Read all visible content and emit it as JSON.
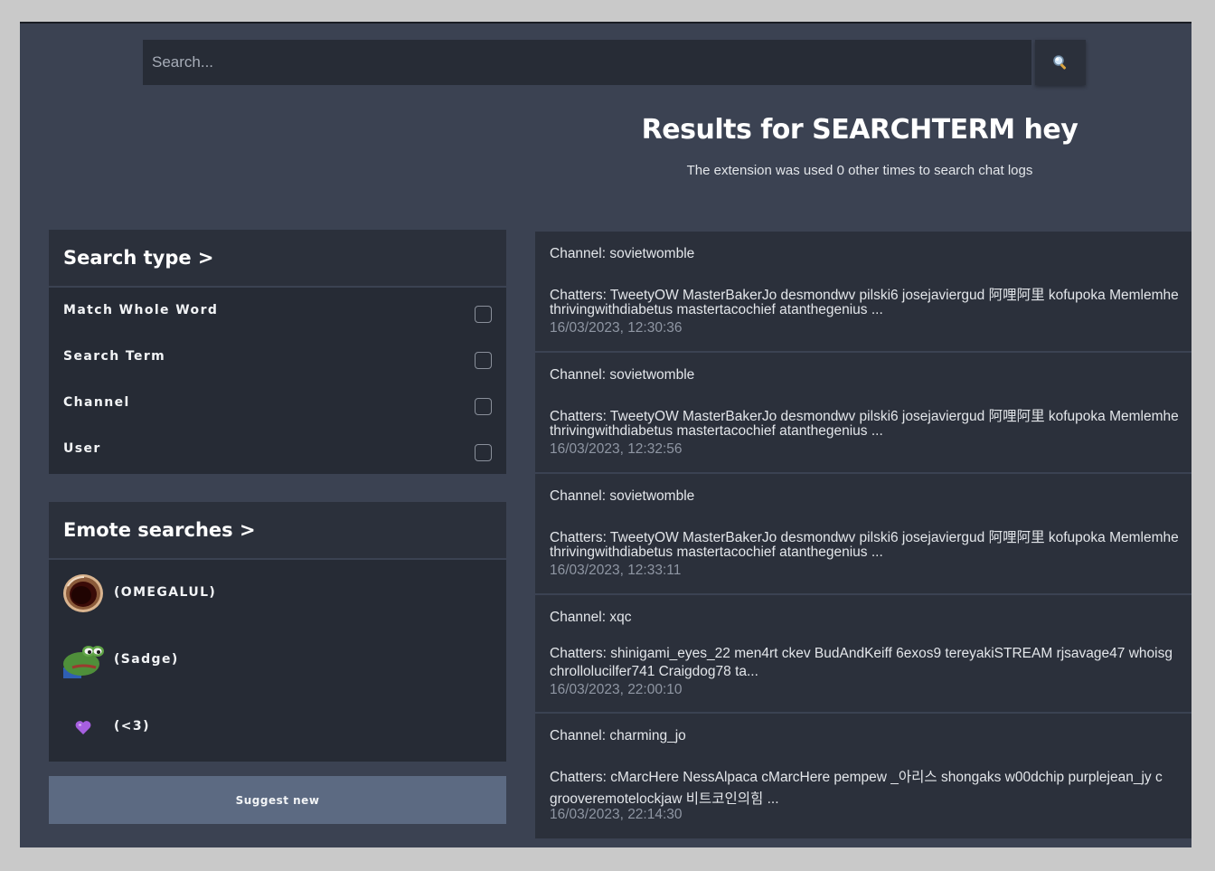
{
  "search": {
    "placeholder": "Search..."
  },
  "header": {
    "title": "Results for SEARCHTERM hey",
    "subtitle": "The extension was used 0 other times to search chat logs"
  },
  "search_type": {
    "title": "Search type >",
    "options": [
      {
        "label": "Match Whole Word",
        "checked": false
      },
      {
        "label": "Search Term",
        "checked": false
      },
      {
        "label": "Channel",
        "checked": false
      },
      {
        "label": "User",
        "checked": false
      }
    ]
  },
  "emote_searches": {
    "title": "Emote searches >",
    "emotes": [
      {
        "label": "(OMEGALUL)",
        "icon": "omegalul-emote-icon"
      },
      {
        "label": "(Sadge)",
        "icon": "sadge-emote-icon"
      },
      {
        "label": "(<3)",
        "icon": "purple-heart-icon"
      }
    ],
    "suggest_label": "Suggest new"
  },
  "results": [
    {
      "channel": "Channel: sovietwomble",
      "chatters_line1": "Chatters: TweetyOW MasterBakerJo desmondwv pilski6 josejaviergud 阿哩阿里 kofupoka Memlemhe",
      "chatters_line2": "thrivingwithdiabetus mastertacochief atanthegenius ...",
      "date": "16/03/2023, 12:30:36"
    },
    {
      "channel": "Channel: sovietwomble",
      "chatters_line1": "Chatters: TweetyOW MasterBakerJo desmondwv pilski6 josejaviergud 阿哩阿里 kofupoka Memlemhe",
      "chatters_line2": "thrivingwithdiabetus mastertacochief atanthegenius ...",
      "date": "16/03/2023, 12:32:56"
    },
    {
      "channel": "Channel: sovietwomble",
      "chatters_line1": "Chatters: TweetyOW MasterBakerJo desmondwv pilski6 josejaviergud 阿哩阿里 kofupoka Memlemhe",
      "chatters_line2": "thrivingwithdiabetus mastertacochief atanthegenius ...",
      "date": "16/03/2023, 12:33:11"
    },
    {
      "channel": "Channel: xqc",
      "chatters_line1": "Chatters: shinigami_eyes_22 men4rt ckev BudAndKeiff 6exos9 tereyakiSTREAM rjsavage47 whoisg",
      "chatters_line2": "chrollolucilfer741 Craigdog78 ta...",
      "date": "16/03/2023, 22:00:10"
    },
    {
      "channel": "Channel: charming_jo",
      "chatters_line1": "Chatters: cMarcHere NessAlpaca cMarcHere pempew _아리스 shongaks w00dchip purplejean_jy c",
      "chatters_line2": "grooveremotelockjaw 비트코인의힘 ...",
      "date": "16/03/2023, 22:14:30"
    }
  ]
}
